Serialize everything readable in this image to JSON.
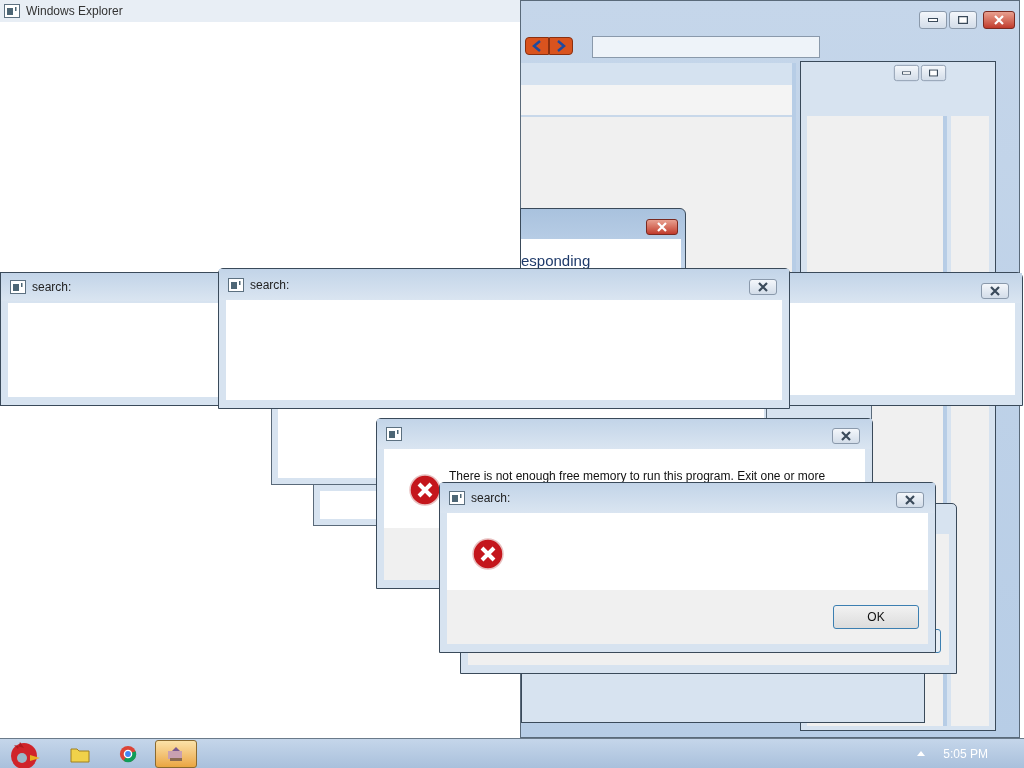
{
  "explorer_window": {
    "title": "Windows Explorer"
  },
  "not_responding_window": {
    "message": "esponding"
  },
  "search_windows": [
    {
      "title": "search:"
    },
    {
      "title": "search:"
    }
  ],
  "memory_error_dialog": {
    "message": "There is not enough free memory to run this program. Exit one or more"
  },
  "error_dialog": {
    "title": "search:",
    "buttons": [
      "OK"
    ]
  },
  "taskbar": {
    "items": [
      {
        "kind": "folder",
        "selected": false
      },
      {
        "kind": "browser",
        "selected": false
      },
      {
        "kind": "app",
        "selected": true
      }
    ],
    "clock": "5:05 PM"
  }
}
